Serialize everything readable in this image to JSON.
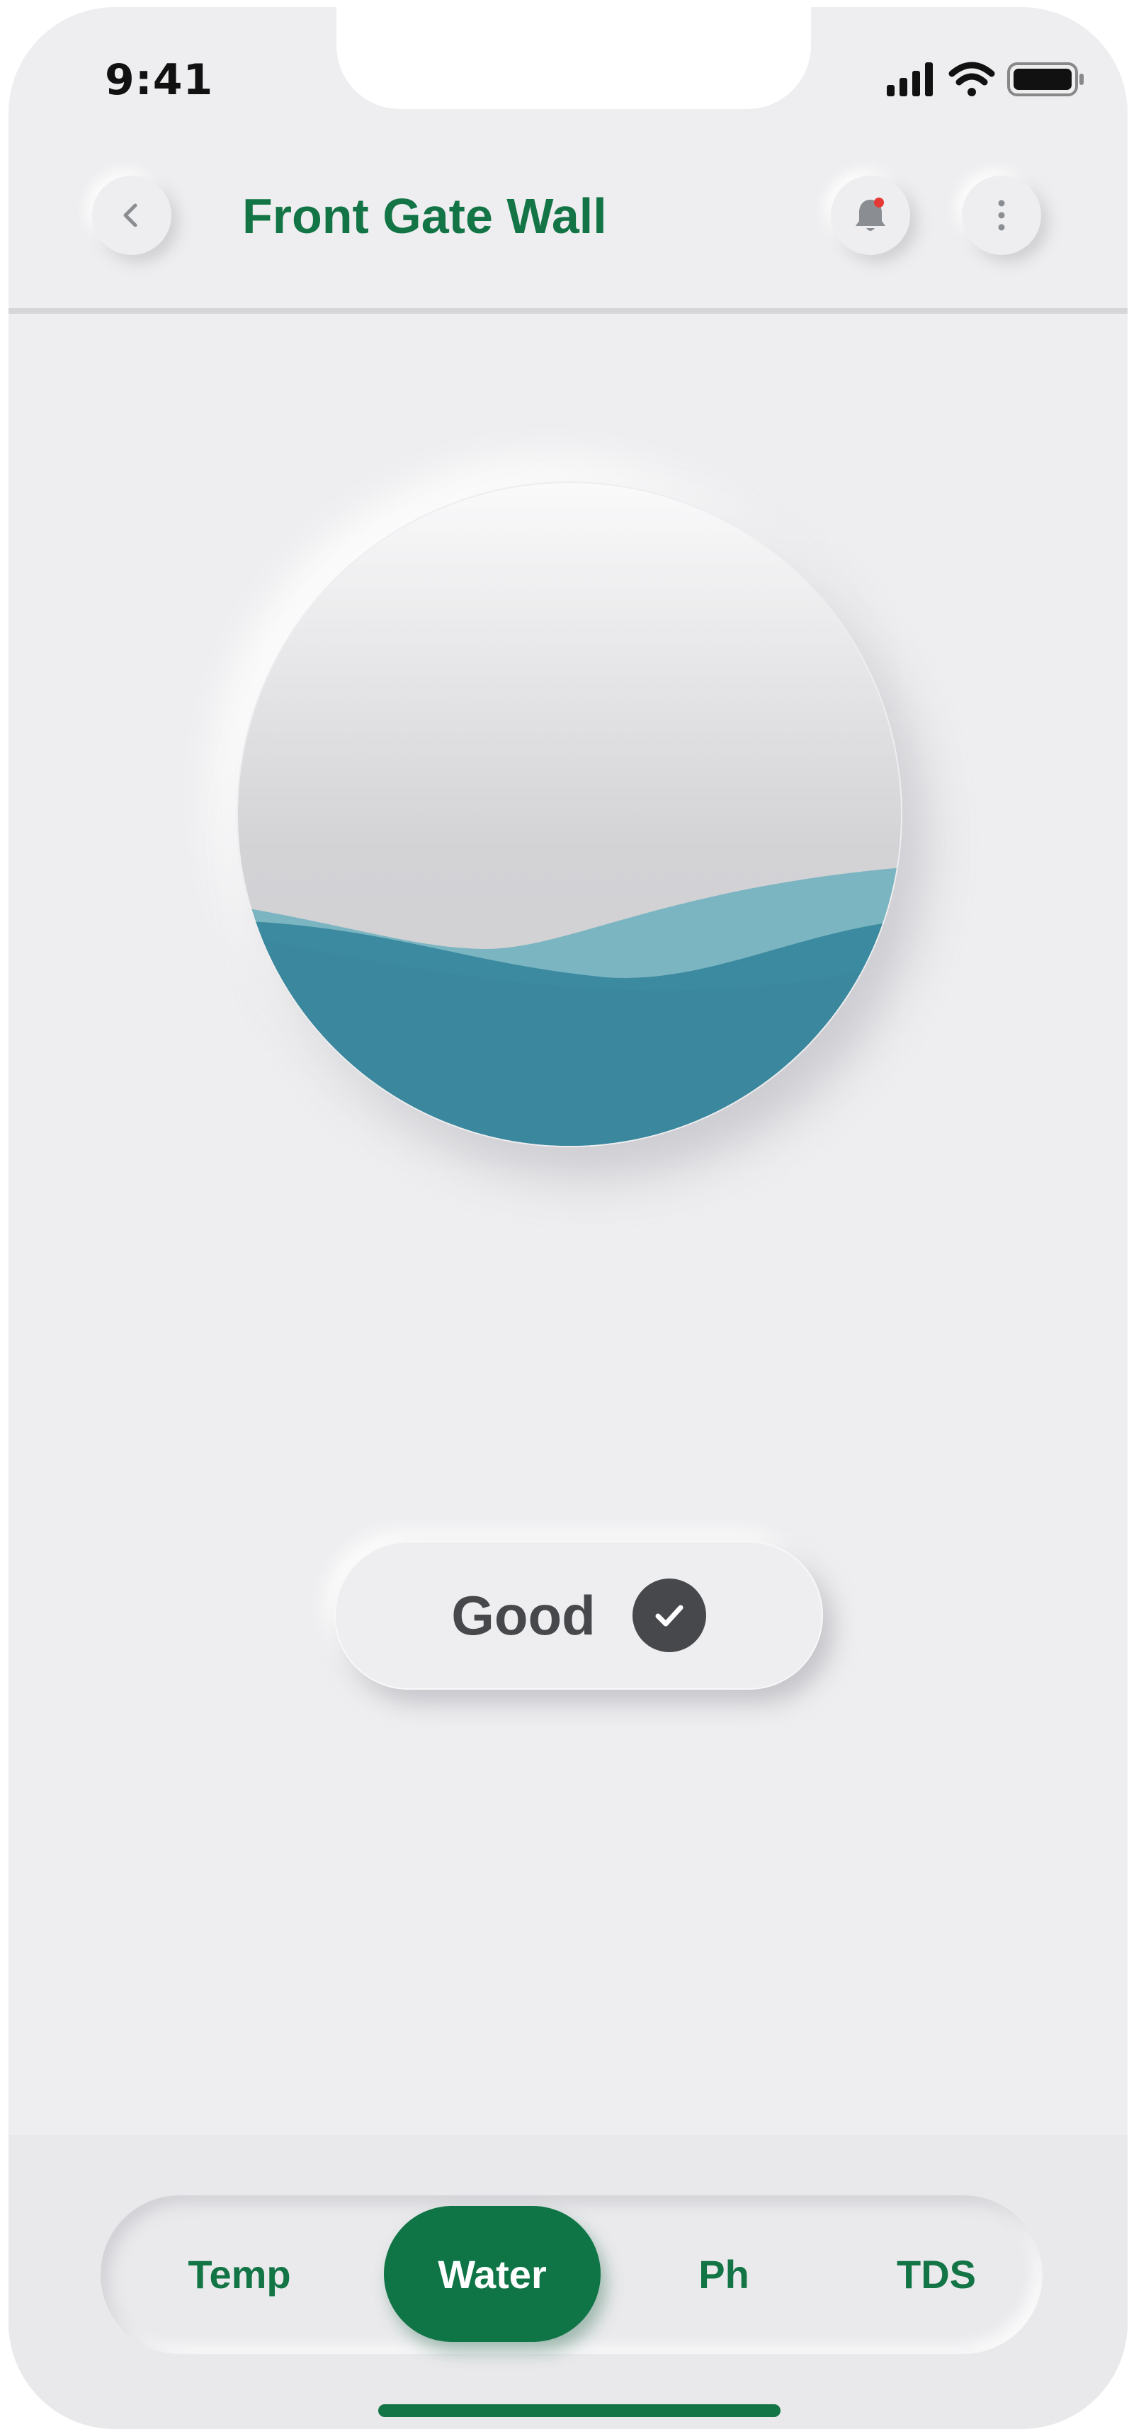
{
  "status_bar": {
    "time": "9:41",
    "signal_icon": "cellular-signal-icon",
    "wifi_icon": "wifi-icon",
    "battery_icon": "battery-icon"
  },
  "header": {
    "title": "Front Gate Wall",
    "back_icon": "chevron-left-icon",
    "notification_icon": "bell-icon",
    "more_icon": "more-vertical-icon",
    "notification_dot_color": "#e53935"
  },
  "gauge": {
    "metric": "Water",
    "water_color": "#3c8aa0",
    "wave_light_color": "#76b3c0"
  },
  "status": {
    "label": "Good",
    "icon": "check-icon"
  },
  "tabs": [
    {
      "label": "Temp",
      "active": false
    },
    {
      "label": "Water",
      "active": true
    },
    {
      "label": "Ph",
      "active": false
    },
    {
      "label": "TDS",
      "active": false
    }
  ],
  "colors": {
    "brand_green": "#137446",
    "background": "#eeeef0",
    "status_dark": "#47484c"
  }
}
